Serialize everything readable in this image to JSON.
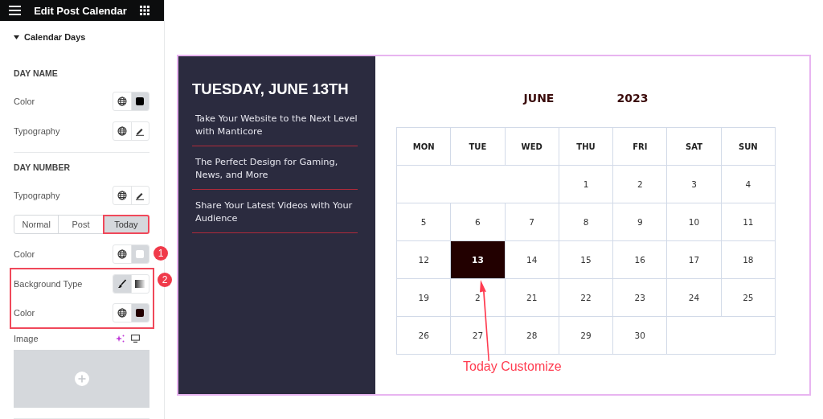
{
  "panel": {
    "title": "Edit Post Calendar",
    "section": {
      "label": "Calendar Days",
      "expanded": true
    }
  },
  "groups": [
    {
      "heading": "DAY NAME",
      "controls": [
        {
          "kind": "color",
          "label": "Color",
          "color": "#000000"
        },
        {
          "kind": "typography",
          "label": "Typography"
        }
      ]
    },
    {
      "heading": "DAY NUMBER",
      "controls": [
        {
          "kind": "typography",
          "label": "Typography"
        }
      ]
    }
  ],
  "state_tabs": [
    {
      "label": "Normal",
      "selected": false,
      "outlined": false
    },
    {
      "label": "Post",
      "selected": false,
      "outlined": false
    },
    {
      "label": "Today",
      "selected": true,
      "outlined": true
    }
  ],
  "today_controls": [
    {
      "kind": "color",
      "label": "Color",
      "color": "#ffffff"
    }
  ],
  "outlined_controls": [
    {
      "kind": "background_type",
      "label": "Background Type",
      "options": [
        {
          "kind": "classic",
          "selected": true
        },
        {
          "kind": "gradient",
          "selected": false
        }
      ]
    },
    {
      "kind": "color",
      "label": "Color",
      "color": "#220000"
    }
  ],
  "image": {
    "label": "Image"
  },
  "callouts": [
    {
      "number": "1"
    },
    {
      "number": "2"
    }
  ],
  "widget": {
    "date_heading": "TUESDAY, JUNE 13TH",
    "posts": [
      {
        "title": "Take Your Website to the Next Level with Manticore"
      },
      {
        "title": "The Perfect Design for Gaming, News, and More"
      },
      {
        "title": "Share Your Latest Videos with Your Audience"
      }
    ],
    "month": "JUNE",
    "year": "2023",
    "weekdays": [
      "MON",
      "TUE",
      "WED",
      "THU",
      "FRI",
      "SAT",
      "SUN"
    ],
    "weeks": [
      [
        {
          "kind": "blank"
        },
        {
          "kind": "day",
          "day": "1",
          "selected": false
        },
        {
          "kind": "day",
          "day": "2",
          "selected": false
        },
        {
          "kind": "day",
          "day": "3",
          "selected": false
        },
        {
          "kind": "day",
          "day": "4",
          "selected": false
        }
      ],
      [
        {
          "kind": "day",
          "day": "5",
          "selected": false
        },
        {
          "kind": "day",
          "day": "6",
          "selected": false
        },
        {
          "kind": "day",
          "day": "7",
          "selected": false
        },
        {
          "kind": "day",
          "day": "8",
          "selected": false
        },
        {
          "kind": "day",
          "day": "9",
          "selected": false
        },
        {
          "kind": "day",
          "day": "10",
          "selected": false
        },
        {
          "kind": "day",
          "day": "11",
          "selected": false
        }
      ],
      [
        {
          "kind": "day",
          "day": "12",
          "selected": false
        },
        {
          "kind": "day",
          "day": "13",
          "selected": true
        },
        {
          "kind": "day",
          "day": "14",
          "selected": false
        },
        {
          "kind": "day",
          "day": "15",
          "selected": false
        },
        {
          "kind": "day",
          "day": "16",
          "selected": false
        },
        {
          "kind": "day",
          "day": "17",
          "selected": false
        },
        {
          "kind": "day",
          "day": "18",
          "selected": false
        }
      ],
      [
        {
          "kind": "day",
          "day": "19",
          "selected": false
        },
        {
          "kind": "day",
          "day": "2",
          "selected": false
        },
        {
          "kind": "day",
          "day": "21",
          "selected": false
        },
        {
          "kind": "day",
          "day": "22",
          "selected": false
        },
        {
          "kind": "day",
          "day": "23",
          "selected": false
        },
        {
          "kind": "day",
          "day": "24",
          "selected": false
        },
        {
          "kind": "day",
          "day": "25",
          "selected": false
        }
      ],
      [
        {
          "kind": "day",
          "day": "26",
          "selected": false
        },
        {
          "kind": "day",
          "day": "27",
          "selected": false
        },
        {
          "kind": "day",
          "day": "28",
          "selected": false
        },
        {
          "kind": "day",
          "day": "29",
          "selected": false
        },
        {
          "kind": "day",
          "day": "30",
          "selected": false
        },
        {
          "kind": "blank"
        }
      ]
    ]
  },
  "annotation": "Today Customize"
}
